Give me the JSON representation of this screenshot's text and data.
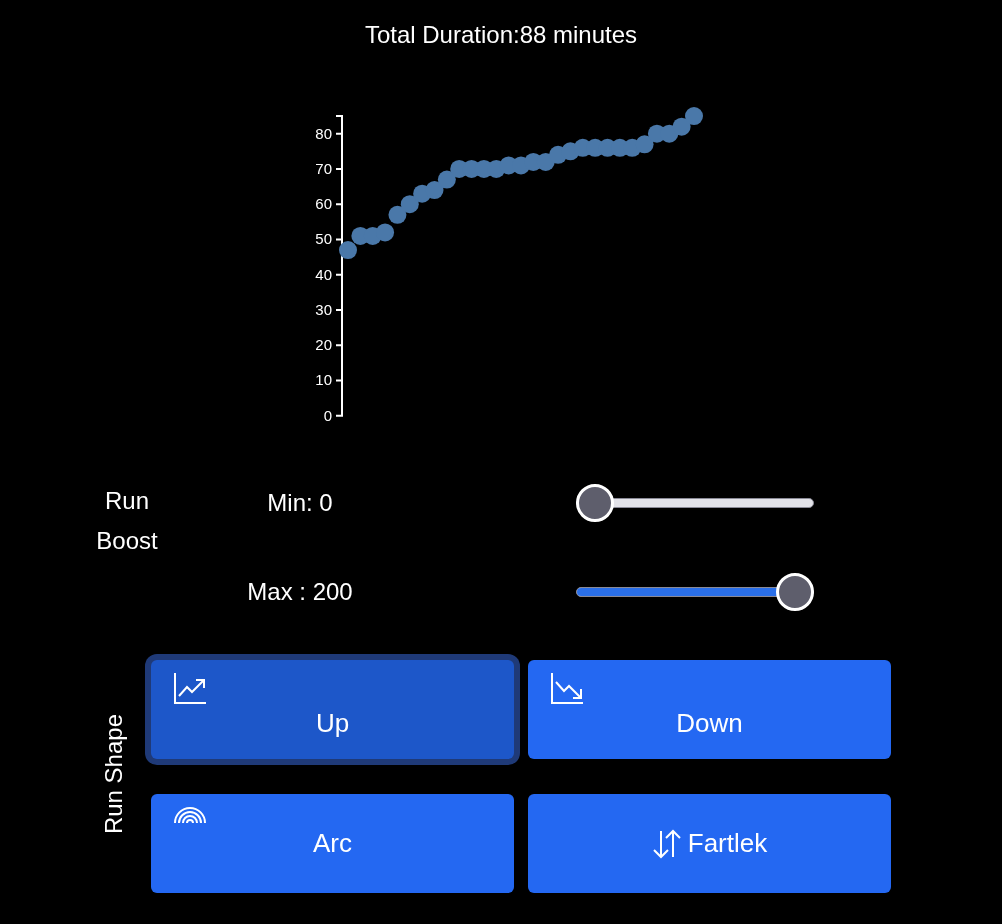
{
  "title": "Total Duration:88 minutes",
  "chart": {
    "y_axis_labels": [
      "80",
      "70",
      "60",
      "50",
      "40",
      "30",
      "20",
      "10",
      "0"
    ]
  },
  "run_boost": {
    "label": "Run Boost",
    "sliders": [
      {
        "label": "Min: 0",
        "level": 0
      },
      {
        "label": "Max : 200",
        "level": 1
      }
    ]
  },
  "run_shape": {
    "label": "Run Shape",
    "buttons": [
      {
        "label": "Up",
        "kind": "rising",
        "selected": true
      },
      {
        "label": "Down",
        "kind": "falling",
        "selected": false
      },
      {
        "label": "Arc",
        "kind": "arc",
        "selected": false
      },
      {
        "label": "Fartlek",
        "kind": "alternating",
        "selected": false
      }
    ]
  }
}
